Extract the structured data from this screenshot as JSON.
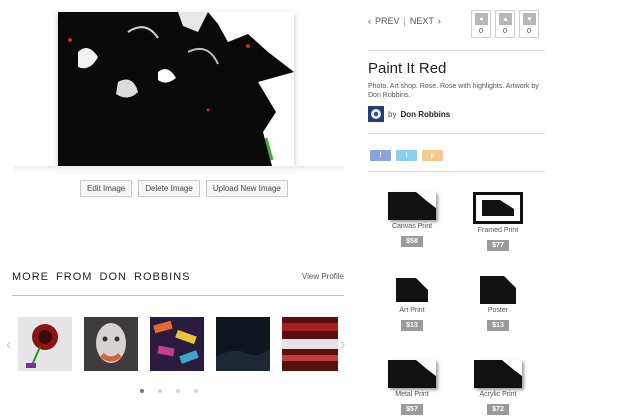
{
  "edit_buttons": {
    "edit": "Edit Image",
    "delete": "Delete Image",
    "upload": "Upload New Image"
  },
  "more": {
    "title": "MORE FROM DON ROBBINS",
    "view_profile": "View Profile",
    "dots_active": 0
  },
  "nav": {
    "prev": "PREV",
    "sep": "|",
    "next": "NEXT"
  },
  "counters": [
    {
      "icon": "comment-icon",
      "count": "0"
    },
    {
      "icon": "thumbs-up-icon",
      "count": "0"
    },
    {
      "icon": "heart-icon",
      "count": "0"
    }
  ],
  "artwork": {
    "title": "Paint It Red",
    "description": "Photo. Art shop. Rose. Rose with highlights. Artwork by Don Robbins.",
    "by": "by",
    "artist": "Don Robbins"
  },
  "share": [
    {
      "icon": "facebook-icon",
      "glyph": "f",
      "color": "#8aa3d9"
    },
    {
      "icon": "twitter-icon",
      "glyph": "t",
      "color": "#8ccdf2"
    },
    {
      "icon": "pinterest-icon",
      "glyph": "p",
      "color": "#f3c992"
    }
  ],
  "products": [
    {
      "name": "Canvas Print",
      "price": "$58"
    },
    {
      "name": "Framed Print",
      "price": "$77"
    },
    {
      "name": "Art Print",
      "price": "$13"
    },
    {
      "name": "Poster",
      "price": "$13"
    },
    {
      "name": "Metal Print",
      "price": "$57"
    },
    {
      "name": "Acrylic Print",
      "price": "$72"
    }
  ]
}
